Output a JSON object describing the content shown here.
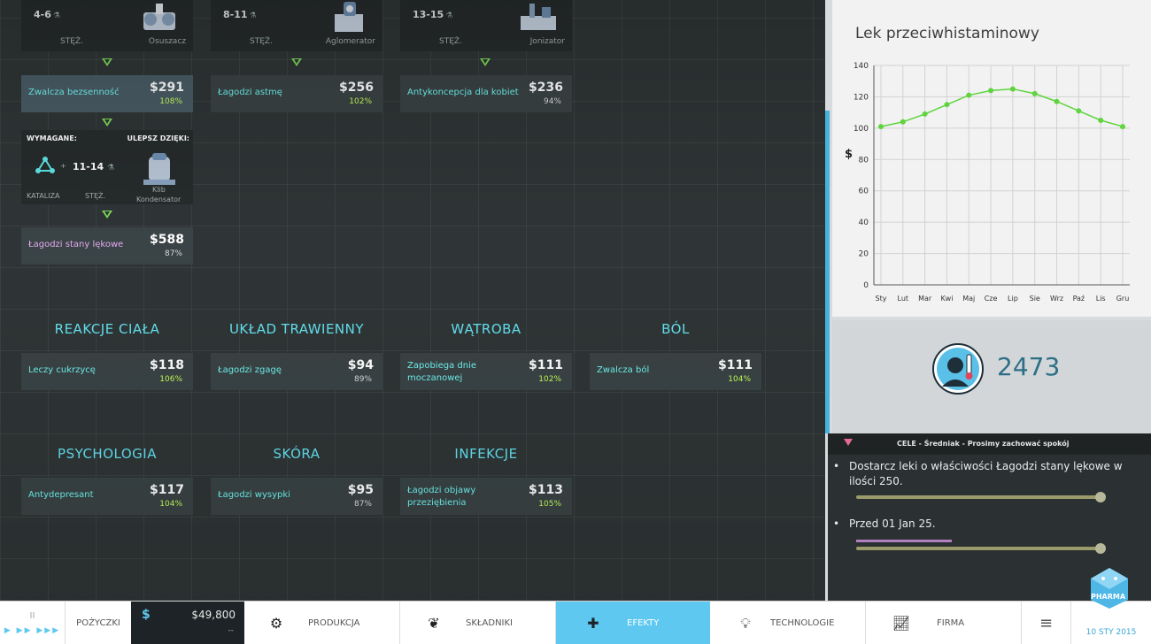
{
  "machines": [
    {
      "range": "4-6",
      "conc": "STĘŻ.",
      "name": "Osuszacz"
    },
    {
      "range": "8-11",
      "conc": "STĘŻ.",
      "name": "Aglomerator"
    },
    {
      "range": "13-15",
      "conc": "STĘŻ.",
      "name": "Jonizator"
    }
  ],
  "top_effects": [
    {
      "name": "Zwalcza bezsenność",
      "price": "$291",
      "pct": "108%"
    },
    {
      "name": "Łagodzi astmę",
      "price": "$256",
      "pct": "102%"
    },
    {
      "name": "Antykoncepcja dla kobiet",
      "price": "$236",
      "pct": "94%"
    }
  ],
  "requirement": {
    "required_label": "WYMAGANE:",
    "upgrade_label": "ULEPSZ DZIĘKI:",
    "range": "11-14",
    "catalysis": "KATALIZA",
    "conc": "STĘŻ.",
    "machine": "Kondensator",
    "machine_prefix": "Klib"
  },
  "anxiety_effect": {
    "name": "Łagodzi stany lękowe",
    "price": "$588",
    "pct": "87%"
  },
  "categories": [
    {
      "title": "REAKCJE CIAŁA",
      "effect": {
        "name": "Leczy cukrzycę",
        "price": "$118",
        "pct": "106%"
      }
    },
    {
      "title": "UKŁAD TRAWIENNY",
      "effect": {
        "name": "Łagodzi zgagę",
        "price": "$94",
        "pct": "89%"
      }
    },
    {
      "title": "WĄTROBA",
      "effect": {
        "name": "Zapobiega dnie moczanowej",
        "price": "$111",
        "pct": "102%"
      }
    },
    {
      "title": "BÓL",
      "effect": {
        "name": "Zwalcza ból",
        "price": "$111",
        "pct": "104%"
      }
    },
    {
      "title": "PSYCHOLOGIA",
      "effect": {
        "name": "Antydepresant",
        "price": "$117",
        "pct": "104%"
      }
    },
    {
      "title": "SKÓRA",
      "effect": {
        "name": "Łagodzi wysypki",
        "price": "$95",
        "pct": "87%"
      }
    },
    {
      "title": "INFEKCJE",
      "effect": {
        "name": "Łagodzi objawy przeziębienia",
        "price": "$113",
        "pct": "105%"
      }
    }
  ],
  "side": {
    "chart_title": "Lek przeciwhistaminowy",
    "stat_value": "2473"
  },
  "chart_data": {
    "type": "line",
    "title": "Lek przeciwhistaminowy",
    "ylabel": "$",
    "xlabel": "",
    "categories": [
      "Sty",
      "Lut",
      "Mar",
      "Kwi",
      "Maj",
      "Cze",
      "Lip",
      "Sie",
      "Wrz",
      "Paź",
      "Lis",
      "Gru"
    ],
    "series": [
      {
        "values": [
          101,
          104,
          109,
          115,
          121,
          124,
          125,
          122,
          117,
          111,
          105,
          101
        ]
      }
    ],
    "ylim": [
      0,
      140
    ],
    "yticks": [
      "0",
      "20",
      "40",
      "60",
      "80",
      "100",
      "120",
      "140"
    ],
    "grid": true,
    "color": "#5fd43e"
  },
  "goals": {
    "header": "CELE - Średniak - Prosimy zachować spokój",
    "items": [
      "Dostarcz leki o właściwości Łagodzi stany lękowe w ilości 250.",
      "Przed 01 Jan 25."
    ],
    "progress": [
      0.0,
      0.0
    ]
  },
  "bottom": {
    "pause": "II",
    "loans": "POŻYCZKI",
    "money_symbol": "$",
    "money": "$49,800",
    "money_sub": "--",
    "tabs": [
      "PRODUKCJA",
      "SKŁADNIKI",
      "EFEKTY",
      "TECHNOLOGIE",
      "FIRMA"
    ],
    "menu": "≡",
    "logo": "PHARMA",
    "date": "10 STY 2015"
  },
  "colors": {
    "accent": "#5ec8f0",
    "effect_text": "#6ff3ef",
    "pct": "#c3ff5a",
    "heading": "#63e2f0"
  }
}
